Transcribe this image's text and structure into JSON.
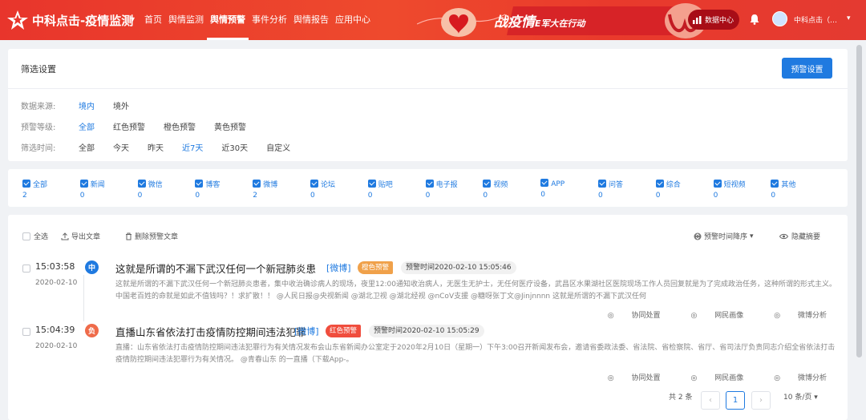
{
  "header": {
    "brand": "中科点击-疫情监测",
    "nav": [
      "首页",
      "舆情监测",
      "舆情预警",
      "事件分析",
      "舆情报告",
      "应用中心"
    ],
    "active_nav": 2,
    "banner_main": "战疫情",
    "banner_sub": "E军大在行动",
    "data_center": "数据中心",
    "username": "中科点击（…"
  },
  "filter": {
    "title": "筛选设置",
    "button": "预警设置",
    "rows": [
      {
        "label": "数据来源:",
        "options": [
          "境内",
          "境外"
        ],
        "selected": 0
      },
      {
        "label": "预警等级:",
        "options": [
          "全部",
          "红色预警",
          "橙色预警",
          "黄色预警"
        ],
        "selected": 0
      },
      {
        "label": "筛选时间:",
        "options": [
          "全部",
          "今天",
          "昨天",
          "近7天",
          "近30天",
          "自定义"
        ],
        "selected": 3
      }
    ]
  },
  "types": [
    {
      "label": "全部",
      "count": "2"
    },
    {
      "label": "新闻",
      "count": "0"
    },
    {
      "label": "微信",
      "count": "0"
    },
    {
      "label": "博客",
      "count": "0"
    },
    {
      "label": "微博",
      "count": "2"
    },
    {
      "label": "论坛",
      "count": "0"
    },
    {
      "label": "贴吧",
      "count": "0"
    },
    {
      "label": "电子报",
      "count": "0"
    },
    {
      "label": "视频",
      "count": "0"
    },
    {
      "label": "APP",
      "count": "0"
    },
    {
      "label": "问答",
      "count": "0"
    },
    {
      "label": "综合",
      "count": "0"
    },
    {
      "label": "短视频",
      "count": "0"
    },
    {
      "label": "其他",
      "count": "0"
    }
  ],
  "toolbar": {
    "select_all": "全选",
    "export": "导出文章",
    "delete": "删除预警文章",
    "sort": "预警时间降序",
    "hide_summary": "隐藏摘要"
  },
  "items": [
    {
      "time": "15:03:58",
      "date": "2020-02-10",
      "sentiment": "中",
      "sentiment_color": "#1f7ae0",
      "title": "这就是所谓的不漏下武汉任何一个新冠肺炎患",
      "source": "[微博]",
      "level": "橙色预警",
      "level_color": "#f0a14a",
      "warn_time": "预警时间2020-02-10 15:05:46",
      "summary": "这就是所谓的不漏下武汉任何一个新冠肺炎患者，集中收治确诊病人的现场，夜里12:00通知收治病人，无医生无护士，无任何医疗设备，武昌区水果湖社区医院现场工作人员回复就是为了完成政治任务，这种所谓的形式主义。 中国老百姓的命就是如此不值钱吗？！求扩散！！ @人民日报@央视新闻 @湖北卫视 @湖北经视 @nCoV支援 @糖呀张丁文@Jinjnnnn 这就是所谓的不漏下武汉任何",
      "actions": [
        "协同处置",
        "网民画像",
        "微博分析"
      ]
    },
    {
      "time": "15:04:39",
      "date": "2020-02-10",
      "sentiment": "负",
      "sentiment_color": "#ef6b4a",
      "title": "直播山东省依法打击疫情防控期间违法犯罪",
      "source": "[微博]",
      "level": "红色预警",
      "level_color": "#f04d3d",
      "warn_time": "预警时间2020-02-10 15:05:29",
      "summary": "直播：山东省依法打击疫情防控期间违法犯罪行为有关情况发布会山东省新闻办公室定于2020年2月10日（星期一）下午3:00召开新闻发布会，邀请省委政法委、省法院、省检察院、省厅、省司法厅负责同志介绍全省依法打击疫情防控期间违法犯罪行为有关情况。 @青春山东 的一直播（下载App-。",
      "actions": [
        "协同处置",
        "网民画像",
        "微博分析"
      ]
    }
  ],
  "pagination": {
    "total": "共 2 条",
    "current": "1",
    "page_size": "10 条/页"
  },
  "colors": {
    "accent": "#1f7ae0",
    "header": "#e8352c"
  }
}
